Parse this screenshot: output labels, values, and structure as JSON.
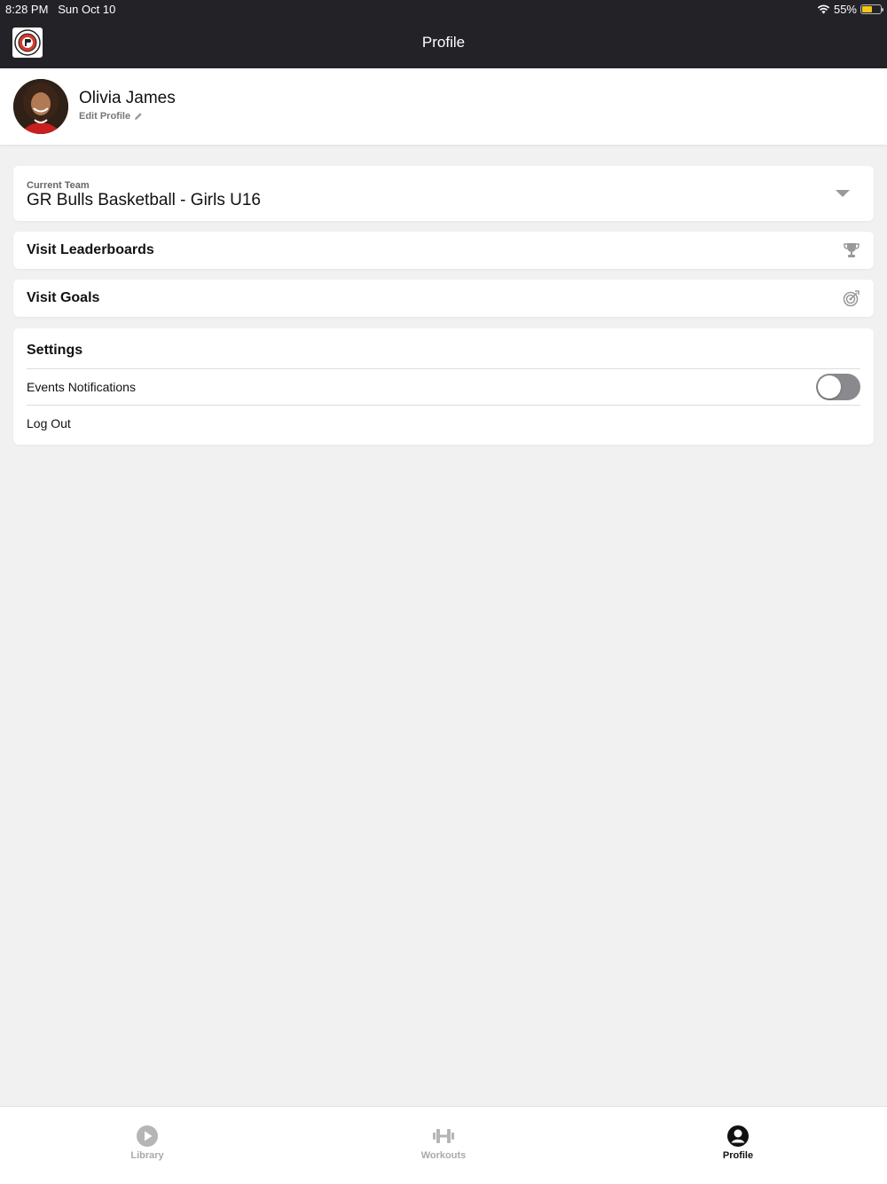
{
  "status_bar": {
    "time": "8:28 PM",
    "date": "Sun Oct 10",
    "battery": "55%",
    "battery_level": 0.55
  },
  "nav": {
    "title": "Profile"
  },
  "profile": {
    "name": "Olivia James",
    "edit_label": "Edit Profile"
  },
  "team": {
    "label": "Current Team",
    "value": "GR Bulls Basketball - Girls U16"
  },
  "links": {
    "leaderboards": "Visit Leaderboards",
    "goals": "Visit Goals"
  },
  "settings": {
    "title": "Settings",
    "events_notifications": "Events Notifications",
    "events_notifications_on": false,
    "log_out": "Log Out"
  },
  "tabs": [
    {
      "label": "Library",
      "icon": "play-circle-icon",
      "active": false
    },
    {
      "label": "Workouts",
      "icon": "dumbbell-icon",
      "active": false
    },
    {
      "label": "Profile",
      "icon": "user-circle-icon",
      "active": true
    }
  ],
  "colors": {
    "header_bg": "#222227",
    "page_bg": "#f1f1f1",
    "toggle_off": "#8a8a8e",
    "battery": "#f5c518"
  }
}
